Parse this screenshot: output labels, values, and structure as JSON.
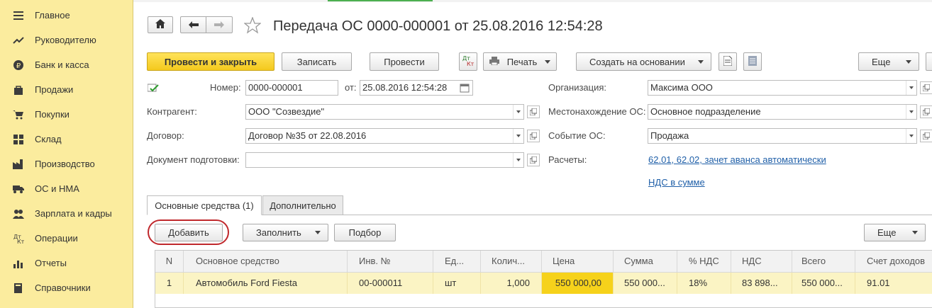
{
  "sidebar": {
    "items": [
      {
        "label": "Главное",
        "icon": "menu-icon"
      },
      {
        "label": "Руководителю",
        "icon": "trend-icon"
      },
      {
        "label": "Банк и касса",
        "icon": "ruble-coin-icon"
      },
      {
        "label": "Продажи",
        "icon": "bag-icon"
      },
      {
        "label": "Покупки",
        "icon": "cart-icon"
      },
      {
        "label": "Склад",
        "icon": "warehouse-icon"
      },
      {
        "label": "Производство",
        "icon": "factory-icon"
      },
      {
        "label": "ОС и НМА",
        "icon": "truck-icon"
      },
      {
        "label": "Зарплата и кадры",
        "icon": "people-icon"
      },
      {
        "label": "Операции",
        "icon": "dt-kt-icon"
      },
      {
        "label": "Отчеты",
        "icon": "bar-chart-icon"
      },
      {
        "label": "Справочники",
        "icon": "book-icon"
      }
    ]
  },
  "header": {
    "title": "Передача ОС 0000-000001 от 25.08.2016 12:54:28"
  },
  "toolbar": {
    "post_close": "Провести и закрыть",
    "save": "Записать",
    "post": "Провести",
    "dt_kt": "Дт Кт",
    "print": "Печать",
    "create_based": "Создать на основании",
    "more": "Еще"
  },
  "form": {
    "number_label": "Номер:",
    "number_value": "0000-000001",
    "date_label": "от:",
    "date_value": "25.08.2016 12:54:28",
    "contractor_label": "Контрагент:",
    "contractor_value": "ООО \"Созвездие\"",
    "contract_label": "Договор:",
    "contract_value": "Договор №35 от 22.08.2016",
    "prep_doc_label": "Документ подготовки:",
    "prep_doc_value": "",
    "org_label": "Организация:",
    "org_value": "Максима ООО",
    "location_label": "Местонахождение ОС:",
    "location_value": "Основное подразделение",
    "event_label": "Событие ОС:",
    "event_value": "Продажа",
    "settlements_label": "Расчеты:",
    "settlements_link": "62.01, 62.02, зачет аванса автоматически",
    "vat_link": "НДС в сумме"
  },
  "tabs": [
    {
      "label": "Основные средства (1)",
      "active": true
    },
    {
      "label": "Дополнительно",
      "active": false
    }
  ],
  "table_toolbar": {
    "add": "Добавить",
    "fill": "Заполнить",
    "select": "Подбор",
    "more": "Еще"
  },
  "table": {
    "columns": [
      "N",
      "Основное средство",
      "Инв. №",
      "Ед...",
      "Колич...",
      "Цена",
      "Сумма",
      "% НДС",
      "НДС",
      "Всего",
      "Счет доходов"
    ],
    "rows": [
      [
        "1",
        "Автомобиль Ford Fiesta",
        "00-000011",
        "шт",
        "1,000",
        "550 000,00",
        "550 000...",
        "18%",
        "83 898...",
        "550 000...",
        "91.01"
      ]
    ]
  },
  "colors": {
    "sidebar_bg": "#fbec9e",
    "primary_button": "#f4c91d",
    "link": "#1f5fa8",
    "selected_row": "#fbf4c4",
    "highlight_cell": "#f6d21b",
    "annotation_circle": "#c0282c"
  }
}
